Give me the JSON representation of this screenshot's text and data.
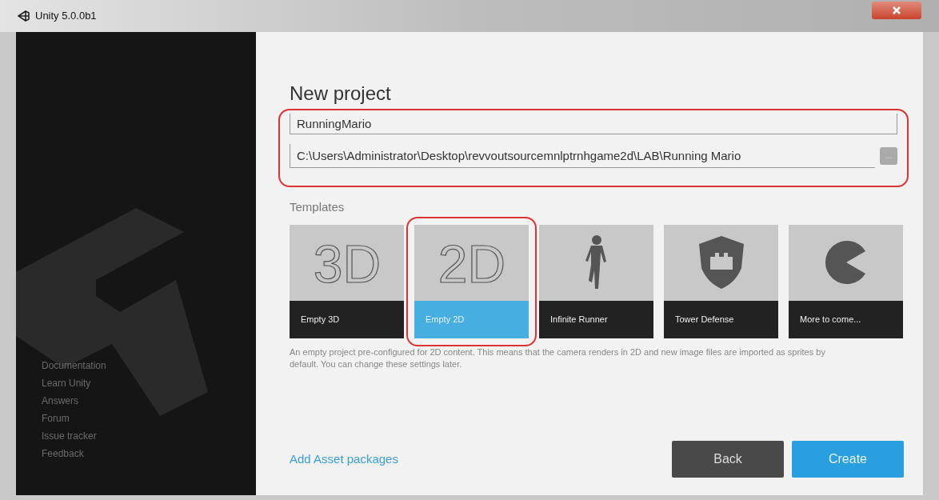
{
  "window": {
    "title": "Unity 5.0.0b1"
  },
  "sidebar": {
    "links": [
      "Documentation",
      "Learn Unity",
      "Answers",
      "Forum",
      "Issue tracker",
      "Feedback"
    ]
  },
  "heading": "New project",
  "project_name": {
    "value": "RunningMario"
  },
  "location": {
    "value": "C:\\Users\\Administrator\\Desktop\\revvoutsourcemnlptrnhgame2d\\LAB\\Running Mario",
    "browse": "..."
  },
  "templates_label": "Templates",
  "templates": [
    {
      "kind": "text",
      "glyph": "3D",
      "label": "Empty 3D",
      "selected": false
    },
    {
      "kind": "text",
      "glyph": "2D",
      "label": "Empty 2D",
      "selected": true
    },
    {
      "kind": "runner",
      "label": "Infinite Runner",
      "selected": false
    },
    {
      "kind": "shield",
      "label": "Tower Defense",
      "selected": false
    },
    {
      "kind": "pacman",
      "label": "More to come...",
      "selected": false
    }
  ],
  "description": "An empty project pre-configured for 2D content. This means that the camera renders in 2D and new image files are imported as sprites by default. You can change these settings later.",
  "asset_link": "Add Asset packages",
  "buttons": {
    "back": "Back",
    "create": "Create"
  }
}
